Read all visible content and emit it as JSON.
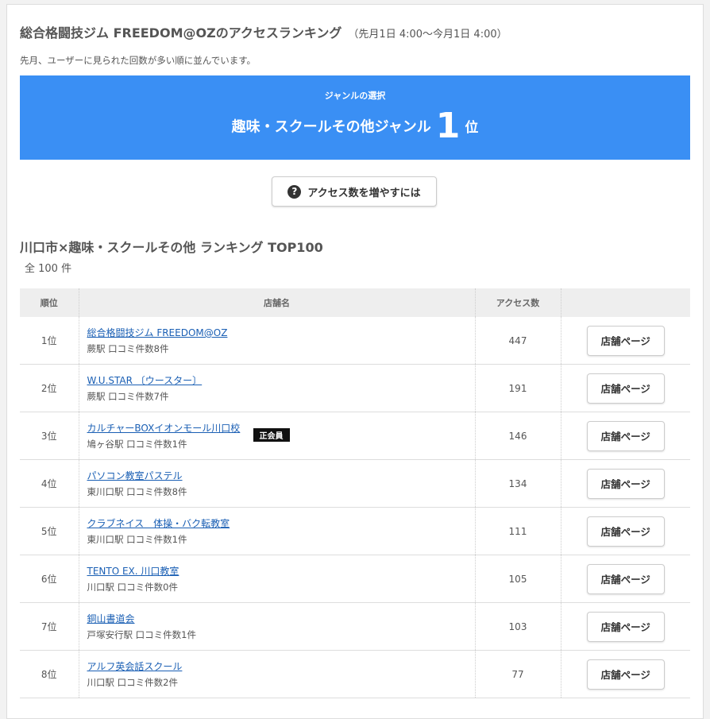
{
  "header": {
    "title": "総合格闘技ジム FREEDOM@OZのアクセスランキング",
    "period": "（先月1日 4:00〜今月1日 4:00）",
    "description": "先月、ユーザーに見られた回数が多い順に並んでいます。"
  },
  "banner": {
    "label": "ジャンルの選択",
    "genre": "趣味・スクールその他ジャンル",
    "rank": "1",
    "unit": "位",
    "color": "#3a8ff4"
  },
  "help_button": {
    "icon": "question-circle-icon",
    "label": "アクセス数を増やすには"
  },
  "ranking": {
    "title": "川口市×趣味・スクールその他 ランキング TOP100",
    "count": "全 100 件",
    "columns": [
      "順位",
      "店舗名",
      "アクセス数",
      ""
    ],
    "rows": [
      {
        "rank": "1位",
        "name": "総合格闘技ジム FREEDOM@OZ",
        "meta": "蕨駅 口コミ件数8件",
        "access": "447",
        "button": "店舗ページ"
      },
      {
        "rank": "2位",
        "name": "W.U.STAR 〔ウースター〕",
        "meta": "蕨駅 口コミ件数7件",
        "access": "191",
        "button": "店舗ページ"
      },
      {
        "rank": "3位",
        "name": "カルチャーBOXイオンモール川口校",
        "meta": "鳩ヶ谷駅 口コミ件数1件",
        "access": "146",
        "button": "店舗ページ",
        "badge": "正会員"
      },
      {
        "rank": "4位",
        "name": "パソコン教室パステル",
        "meta": "東川口駅 口コミ件数8件",
        "access": "134",
        "button": "店舗ページ"
      },
      {
        "rank": "5位",
        "name": "クラブネイス　体操・バク転教室",
        "meta": "東川口駅 口コミ件数1件",
        "access": "111",
        "button": "店舗ページ"
      },
      {
        "rank": "6位",
        "name": "TENTO EX. 川口教室",
        "meta": "川口駅 口コミ件数0件",
        "access": "105",
        "button": "店舗ページ"
      },
      {
        "rank": "7位",
        "name": "銅山書道会",
        "meta": "戸塚安行駅 口コミ件数1件",
        "access": "103",
        "button": "店舗ページ"
      },
      {
        "rank": "8位",
        "name": "アルフ英会話スクール",
        "meta": "川口駅 口コミ件数2件",
        "access": "77",
        "button": "店舗ページ"
      }
    ]
  }
}
